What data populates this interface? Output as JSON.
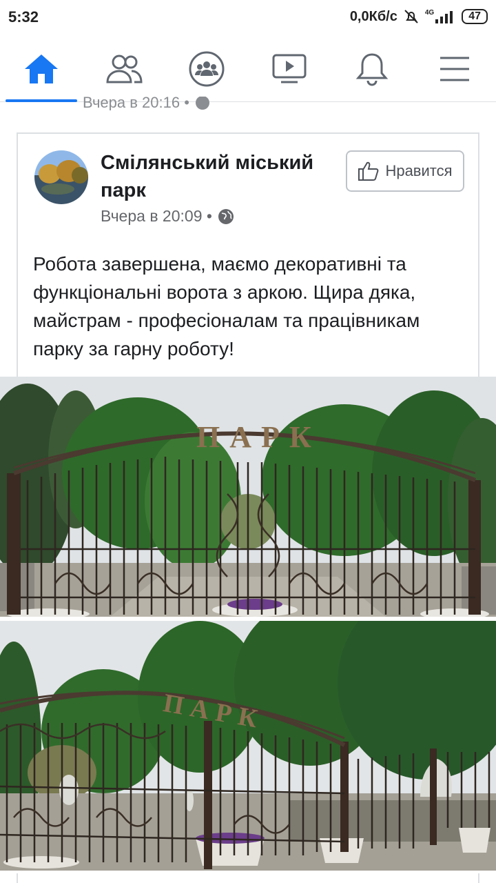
{
  "status": {
    "time": "5:32",
    "speed": "0,0Кб/с",
    "network": "4G",
    "battery": "47"
  },
  "nav": {
    "items": [
      "home-icon",
      "friends-icon",
      "groups-icon",
      "watch-icon",
      "notifications-icon",
      "menu-icon"
    ],
    "active_color": "#1877f2",
    "icon_color": "#606770"
  },
  "prev_post": {
    "time": "Вчера в 20:16 •"
  },
  "post": {
    "page_name": "Смілянський міський парк",
    "time": "Вчера в 20:09 •",
    "like_label": "Нравится",
    "text": "Робота завершена, маємо декоративні та функціональні ворота з аркою. Щира дяка, майстрам - професіоналам та працівникам парку за гарну роботу!",
    "photo_sign": "ПАРК"
  }
}
